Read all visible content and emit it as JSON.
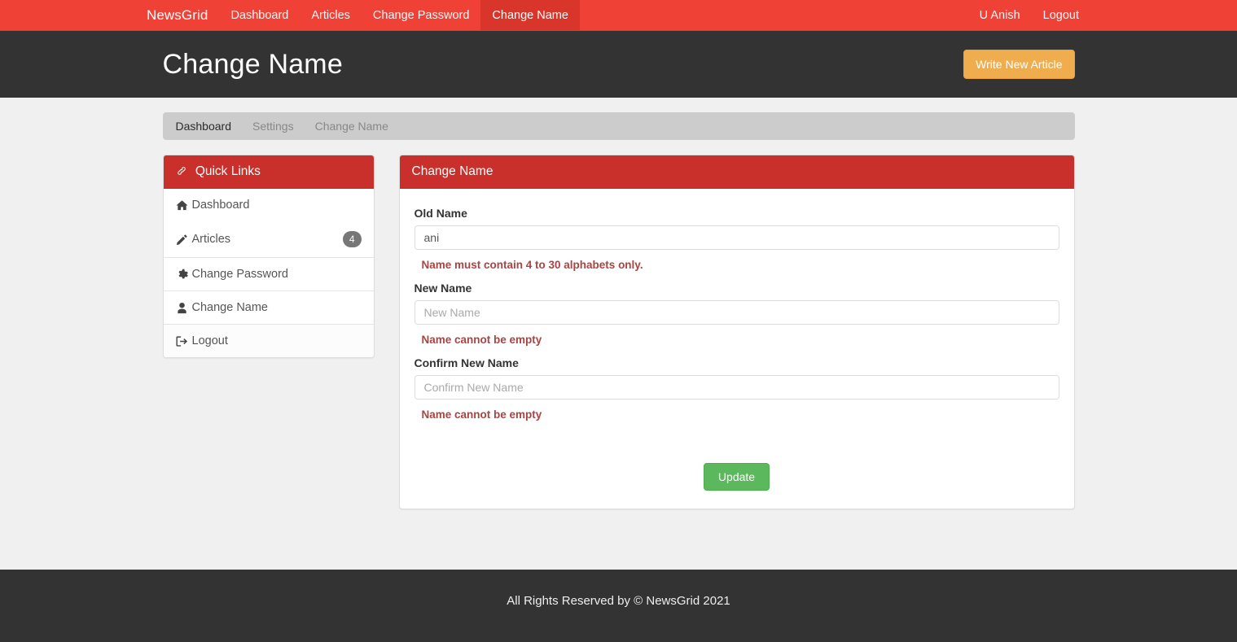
{
  "navbar": {
    "brand": "NewsGrid",
    "items": [
      {
        "label": "Dashboard",
        "active": false
      },
      {
        "label": "Articles",
        "active": false
      },
      {
        "label": "Change Password",
        "active": false
      },
      {
        "label": "Change Name",
        "active": true
      }
    ],
    "right_items": [
      {
        "label": "U Anish"
      },
      {
        "label": "Logout"
      }
    ],
    "background_color": "#ef4136",
    "active_color": "#d9352a"
  },
  "header": {
    "title": "Change Name",
    "write_button": "Write New Article",
    "write_button_color": "#f0ad4e",
    "background_color": "#333333"
  },
  "breadcrumb": {
    "items": [
      {
        "label": "Dashboard",
        "muted": false
      },
      {
        "label": "Settings",
        "muted": true
      },
      {
        "label": "Change Name",
        "muted": true
      }
    ],
    "background_color": "#cccccc"
  },
  "sidebar": {
    "heading": "Quick Links",
    "heading_icon": "link-icon",
    "heading_color": "#c9302c",
    "items": [
      {
        "label": "Dashboard",
        "icon": "home-icon",
        "badge": ""
      },
      {
        "label": "Articles",
        "icon": "pencil-icon",
        "badge": "4"
      },
      {
        "label": "Change Password",
        "icon": "gear-icon",
        "badge": ""
      },
      {
        "label": "Change Name",
        "icon": "user-icon",
        "badge": ""
      },
      {
        "label": "Logout",
        "icon": "sign-out-icon",
        "badge": ""
      }
    ],
    "badge_color": "#777777"
  },
  "form_panel": {
    "title": "Change Name",
    "title_color": "#c9302c",
    "fields": [
      {
        "label": "Old Name",
        "value": "ani",
        "placeholder": "Old Name",
        "error": "Name must contain 4 to 30 alphabets only."
      },
      {
        "label": "New Name",
        "value": "",
        "placeholder": "New Name",
        "error": "Name cannot be empty"
      },
      {
        "label": "Confirm New Name",
        "value": "",
        "placeholder": "Confirm New Name",
        "error": "Name cannot be empty"
      }
    ],
    "submit_label": "Update",
    "submit_color": "#5cb85c",
    "error_color": "#a94442"
  },
  "footer": {
    "text": "All Rights Reserved by © NewsGrid 2021",
    "background_color": "#333333"
  }
}
